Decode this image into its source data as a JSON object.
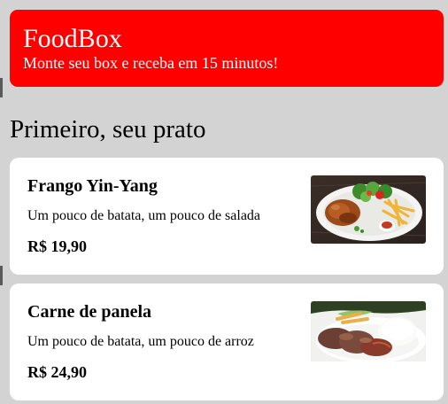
{
  "header": {
    "title": "FoodBox",
    "subtitle": "Monte seu box e receba em 15 minutos!",
    "background_color": "#ff0000"
  },
  "section": {
    "title": "Primeiro, seu prato"
  },
  "dishes": [
    {
      "name": "Frango Yin-Yang",
      "description": "Um pouco de batata, um pouco de salada",
      "price": "R$ 19,90",
      "image": "chicken-fries-salad-photo"
    },
    {
      "name": "Carne de panela",
      "description": "Um pouco de batata, um pouco de arroz",
      "price": "R$ 24,90",
      "image": "pot-roast-rice-photo"
    }
  ]
}
